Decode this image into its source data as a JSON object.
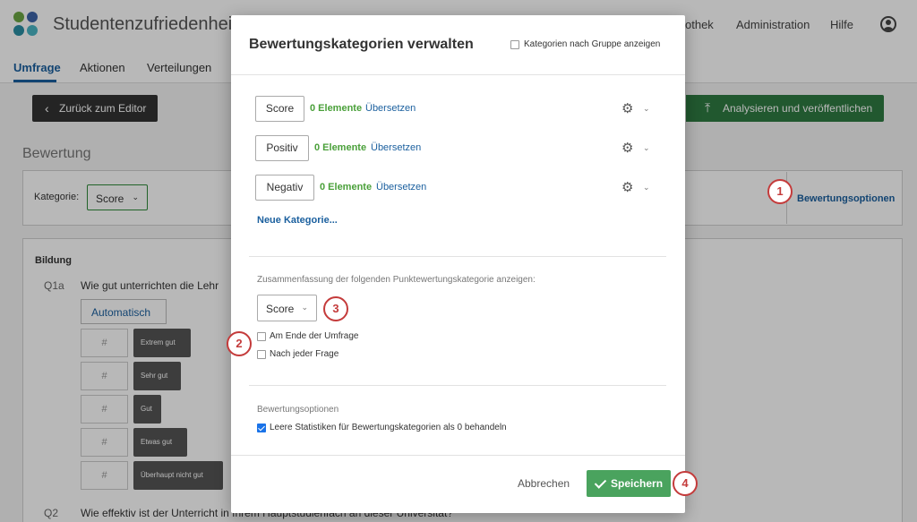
{
  "app": {
    "title": "Studentenzufriedenheit",
    "logo_colors": [
      "#6ba543",
      "#3d64a8",
      "#2a8ea3",
      "#4ab5c4"
    ],
    "top_links": [
      "othek",
      "Administration",
      "Hilfe"
    ],
    "user_icon": "user-circle-icon"
  },
  "nav": {
    "tabs": [
      "Umfrage",
      "Aktionen",
      "Verteilungen"
    ],
    "active_tab": "Umfrage"
  },
  "toolbar": {
    "back_label": "Zurück zum Editor",
    "publish_label": "Analysieren und veröffentlichen"
  },
  "bewertung": {
    "title": "Bewertung",
    "kategorie_label": "Kategorie:",
    "kategorie_value": "Score",
    "options_link": "Bewertungsoptionen"
  },
  "questions": {
    "block_title": "Bildung",
    "q1_num": "Q1a",
    "q1_text": "Wie gut unterrichten die Lehr",
    "auto_label": "Automatisch",
    "hash": "#",
    "answers": [
      "Extrem gut",
      "Sehr gut",
      "Gut",
      "Etwas gut",
      "Überhaupt nicht gut"
    ],
    "q2_num": "Q2",
    "q2_text": "Wie effektiv ist der Unterricht in Ihrem Hauptstudienfach an dieser Universität?"
  },
  "modal": {
    "title": "Bewertungskategorien verwalten",
    "group_checkbox_label": "Kategorien nach Gruppe anzeigen",
    "group_checkbox_checked": false,
    "categories": [
      {
        "name": "Score",
        "count": "0 Elemente",
        "translate": "Übersetzen"
      },
      {
        "name": "Positiv",
        "count": "0 Elemente",
        "translate": "Übersetzen"
      },
      {
        "name": "Negativ",
        "count": "0 Elemente",
        "translate": "Übersetzen"
      }
    ],
    "gear_icon": "gear-icon",
    "new_category": "Neue Kategorie...",
    "summary_label": "Zusammenfassung der folgenden Punktewertungskategorie anzeigen:",
    "summary_select": "Score",
    "end_of_survey": "Am Ende der Umfrage",
    "end_of_survey_checked": false,
    "after_each": "Nach jeder Frage",
    "after_each_checked": false,
    "options_heading": "Bewertungsoptionen",
    "treat_empty": "Leere Statistiken für Bewertungskategorien als 0 behandeln",
    "treat_empty_checked": true,
    "cancel": "Abbrechen",
    "save": "Speichern"
  },
  "callouts": [
    "1",
    "2",
    "3",
    "4"
  ],
  "colors": {
    "accent_blue": "#1a5f9e",
    "green": "#4aa35e",
    "callout_red": "#c43b3b"
  }
}
